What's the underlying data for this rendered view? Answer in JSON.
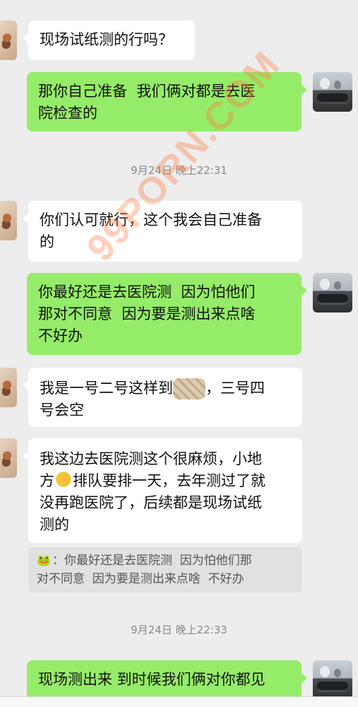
{
  "messages": {
    "m1": "现场试纸测的行吗？",
    "m2": "那你自己准备  我们俩对都是去医\n院检查的",
    "m3": "你们认可就行，这个我会自己准备\n的",
    "m4": "你最好还是去医院测  因为怕他们\n那对不同意  因为要是测出来点啥\n不好办",
    "m5_a": "我是一号二号这样到",
    "m5_b": "，三号四\n号会空",
    "m6_a": "我这边去医院测这个很麻烦，小地\n方",
    "m6_b": "排队要排一天，去年测过了就\n没再跑医院了，后续都是现场试纸\n测的",
    "m7": "现场测出来 到时候我们俩对你都见"
  },
  "timestamps": {
    "t1": "9月24日 晚上22:31",
    "t2": "9月24日 晚上22:33"
  },
  "quote": {
    "text": "：你最好还是去医院测  因为怕他们那\n对不同意  因为要是测出来点啥  不好办",
    "icon": "frog-emoji"
  },
  "watermark": "99PORN.COM",
  "colors": {
    "background": "#ededed",
    "incoming_bubble": "#ffffff",
    "outgoing_bubble": "#95ec69"
  }
}
